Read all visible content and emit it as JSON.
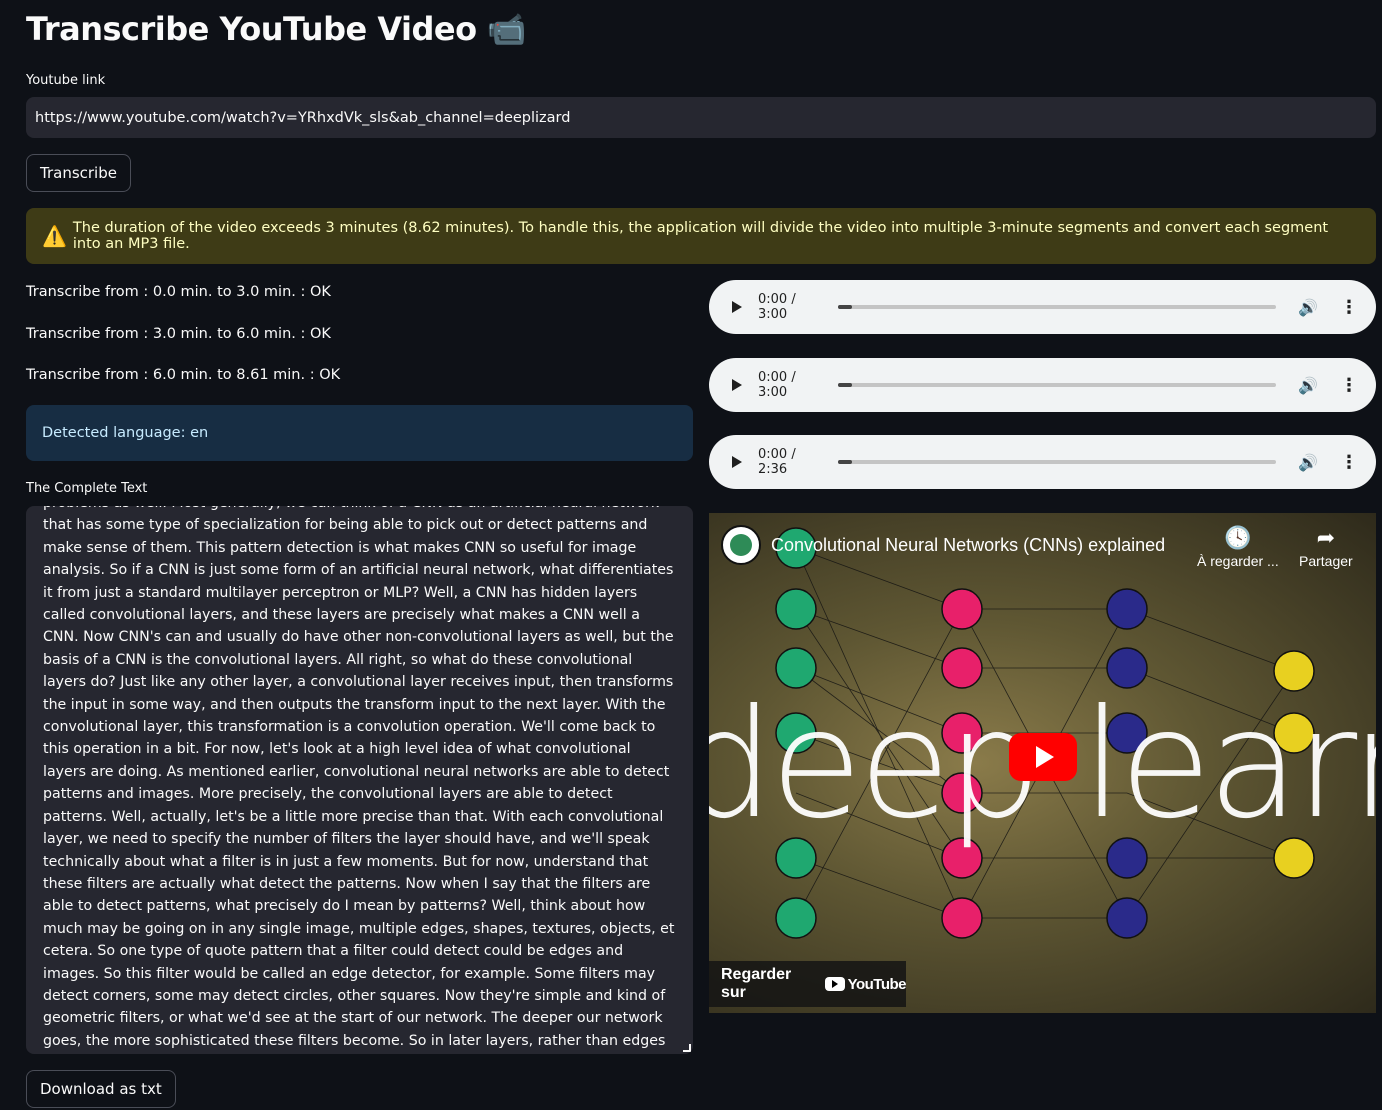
{
  "page": {
    "title": "Transcribe YouTube Video",
    "title_icon": "📹"
  },
  "link_field": {
    "label": "Youtube link",
    "value": "https://www.youtube.com/watch?v=YRhxdVk_sls&ab_channel=deeplizard"
  },
  "transcribe_button": "Transcribe",
  "warning": {
    "icon": "⚠️",
    "text": "The duration of the video exceeds 3 minutes (8.62 minutes). To handle this, the application will divide the video into multiple 3-minute segments and convert each segment into an MP3 file."
  },
  "segments": [
    "Transcribe from : 0.0 min. to 3.0 min. : OK",
    "Transcribe from : 3.0 min. to 6.0 min. : OK",
    "Transcribe from : 6.0 min. to 8.61 min. : OK"
  ],
  "detected_language": "Detected language: en",
  "complete_text": {
    "label": "The Complete Text",
    "value": "problems as well. Most generally, we can think of a CNN as an artificial neural network that has some type of specialization for being able to pick out or detect patterns and make sense of them. This pattern detection is what makes CNN so useful for image analysis. So if a CNN is just some form of an artificial neural network, what differentiates it from just a standard multilayer perceptron or MLP? Well, a CNN has hidden layers called convolutional layers, and these layers are precisely what makes a CNN well a CNN. Now CNN's can and usually do have other non-convolutional layers as well, but the basis of a CNN is the convolutional layers. All right, so what do these convolutional layers do? Just like any other layer, a convolutional layer receives input, then transforms the input in some way, and then outputs the transform input to the next layer. With the convolutional layer, this transformation is a convolution operation. We'll come back to this operation in a bit. For now, let's look at a high level idea of what convolutional layers are doing. As mentioned earlier, convolutional neural networks are able to detect patterns and images. More precisely, the convolutional layers are able to detect patterns. Well, actually, let's be a little more precise than that. With each convolutional layer, we need to specify the number of filters the layer should have, and we'll speak technically about what a filter is in just a few moments. But for now, understand that these filters are actually what detect the patterns. Now when I say that the filters are able to detect patterns, what precisely do I mean by patterns? Well, think about how much may be going on in any single image, multiple edges, shapes, textures, objects, et cetera. So one type of quote pattern that a filter could detect could be edges and images. So this filter would be called an edge detector, for example. Some filters may detect corners, some may detect circles, other squares. Now they're simple and kind of geometric filters, or what we'd see at the start of our network. The deeper our network goes, the more sophisticated these filters become. So in later layers, rather than edges and simple shapes, our filters may be able to detect specific objects, like eyes, ears, hair, or fur, feathers, scales, and beaks, even. And even deeper layers,"
  },
  "download_button": "Download as txt",
  "audio_players": [
    {
      "time": "0:00 / 3:00",
      "progress": 0
    },
    {
      "time": "0:00 / 3:00",
      "progress": 0
    },
    {
      "time": "0:00 / 2:36",
      "progress": 0
    }
  ],
  "video": {
    "title": "Convolutional Neural Networks (CNNs) explained",
    "watch_later": "À regarder ...",
    "share": "Partager",
    "watch_on": "Regarder sur",
    "youtube_logo_text": "YouTube",
    "thumbnail_text": "deep learning"
  },
  "colors": {
    "background": "#0e1117",
    "input_bg": "#262730",
    "warning_bg": "#3e3b16",
    "info_bg": "#172d43",
    "youtube_red": "#ff0000"
  }
}
